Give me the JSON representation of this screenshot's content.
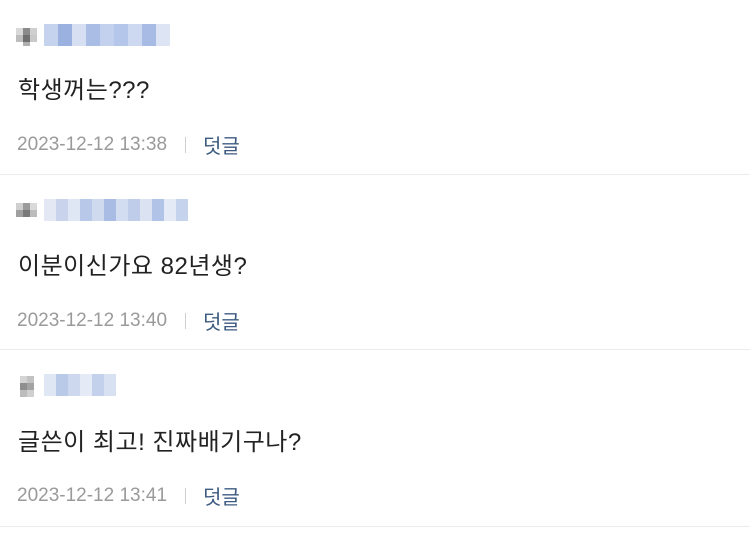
{
  "comments": [
    {
      "text": "학생꺼는???",
      "date": "2023-12-12 13:38",
      "reply_label": "덧글"
    },
    {
      "text": "이분이신가요 82년생?",
      "date": "2023-12-12 13:40",
      "reply_label": "덧글"
    },
    {
      "text": "글쓴이 최고! 진짜배기구나?",
      "date": "2023-12-12 13:41",
      "reply_label": "덧글"
    }
  ],
  "colors": {
    "text": "#222222",
    "meta": "#9a9a9a",
    "reply_link": "#3d5a80",
    "separator": "#ebebeb",
    "blur_gray": "#8c8c8c",
    "blur_blue": "#b9c9e8"
  }
}
